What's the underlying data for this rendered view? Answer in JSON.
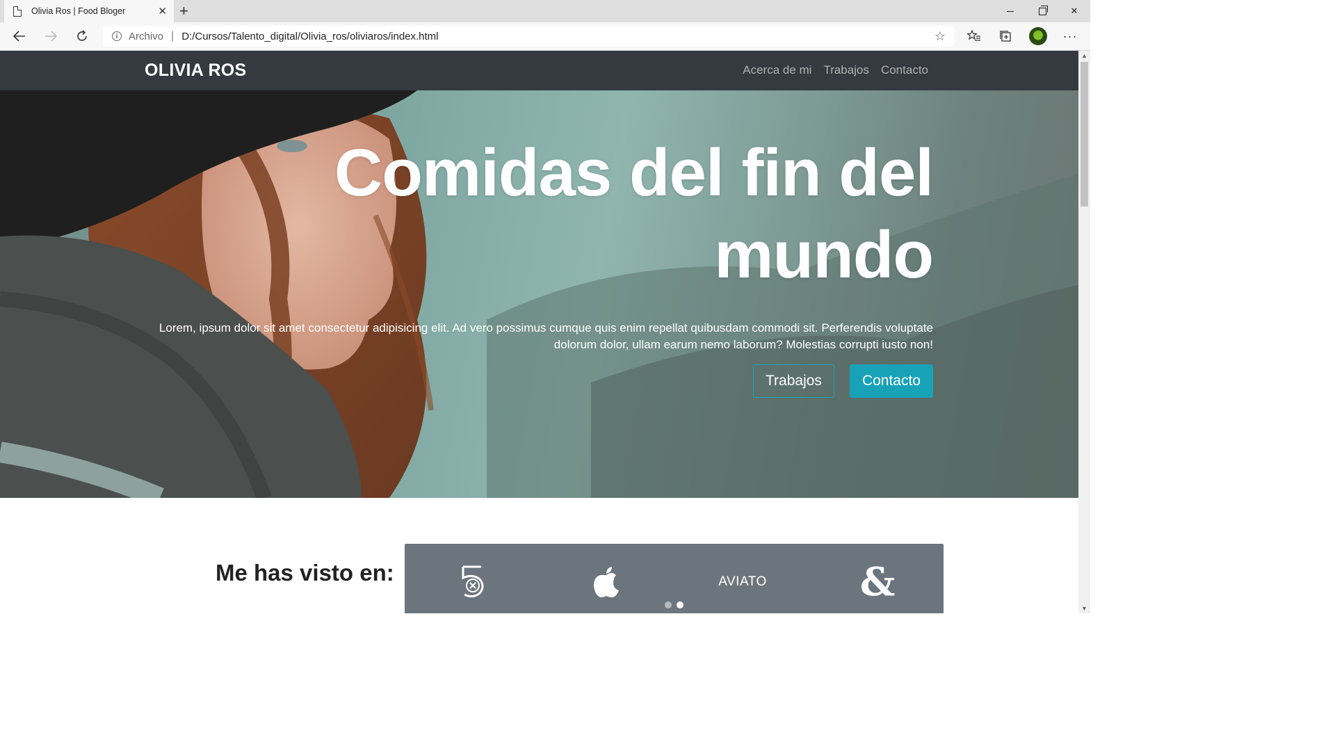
{
  "browser": {
    "tab_title": "Olivia Ros | Food Bloger",
    "tab_close": "✕",
    "new_tab": "+",
    "address_label": "Archivo",
    "address_separator": "|",
    "url": "D:/Cursos/Talento_digital/Olivia_ros/oliviaros/index.html"
  },
  "site": {
    "brand": "OLIVIA ROS",
    "nav_links": [
      "Acerca de mi",
      "Trabajos",
      "Contacto"
    ]
  },
  "hero": {
    "title_line1": "Comidas del fin del",
    "title_line2": "mundo",
    "text": "Lorem, ipsum dolor sit amet consectetur adipisicing elit. Ad vero possimus cumque quis enim repellat quibusdam commodi sit. Perferendis voluptate dolorum dolor, ullam earum nemo laborum? Molestias corrupti iusto non!",
    "buttons": [
      "Trabajos",
      "Contacto"
    ]
  },
  "seen": {
    "title": "Me has visto en:",
    "logos": [
      "five-logo",
      "apple-logo",
      "AVIATO",
      "ampersand-logo"
    ],
    "aviato_text": "AVIATO",
    "carousel_active_index": 1,
    "carousel_count": 2
  },
  "colors": {
    "navbar": "#343a40",
    "accent": "#17a2b8",
    "logo_panel": "#6c757d"
  }
}
